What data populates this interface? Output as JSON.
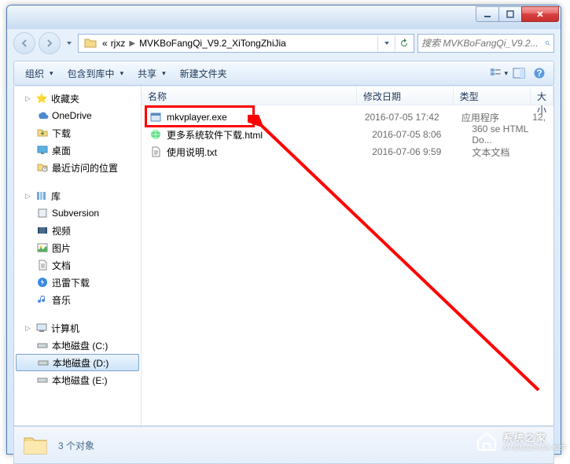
{
  "breadcrumb": {
    "prefix": "«",
    "seg1": "rjxz",
    "seg2": "MVKBoFangQi_V9.2_XiTongZhiJia"
  },
  "search": {
    "placeholder": "搜索 MVKBoFangQi_V9.2..."
  },
  "toolbar": {
    "organize": "组织",
    "include": "包含到库中",
    "share": "共享",
    "newfolder": "新建文件夹"
  },
  "columns": {
    "name": "名称",
    "date": "修改日期",
    "type": "类型",
    "size": "大小"
  },
  "sidebar": {
    "favorites": "收藏夹",
    "fav_items": [
      "OneDrive",
      "下载",
      "桌面",
      "最近访问的位置"
    ],
    "libraries": "库",
    "lib_items": [
      "Subversion",
      "视频",
      "图片",
      "文档",
      "迅雷下载",
      "音乐"
    ],
    "computer": "计算机",
    "drives": [
      "本地磁盘 (C:)",
      "本地磁盘 (D:)",
      "本地磁盘 (E:)"
    ]
  },
  "files": [
    {
      "name": "mkvplayer.exe",
      "date": "2016-07-05 17:42",
      "type": "应用程序",
      "size": "12,"
    },
    {
      "name": "更多系统软件下载.html",
      "date": "2016-07-05 8:06",
      "type": "360 se HTML Do...",
      "size": ""
    },
    {
      "name": "使用说明.txt",
      "date": "2016-07-06 9:59",
      "type": "文本文档",
      "size": ""
    }
  ],
  "status": {
    "count": "3 个对象"
  },
  "watermark": {
    "text": "系统之家",
    "url": "XITONGZHIJIA.NET"
  }
}
